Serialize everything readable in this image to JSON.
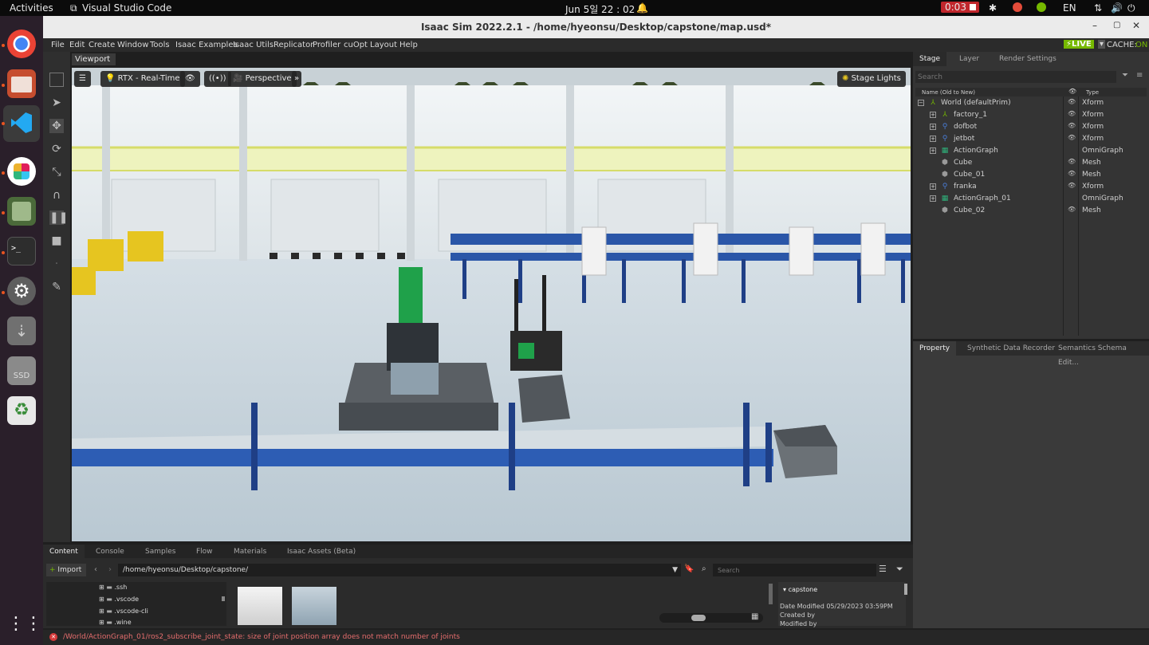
{
  "topbar": {
    "activities": "Activities",
    "app_name": "Visual Studio Code",
    "clock": "Jun 5일 22 : 02",
    "record_time": "0:03",
    "lang": "EN"
  },
  "window": {
    "title": "Isaac Sim 2022.2.1 - /home/hyeonsu/Desktop/capstone/map.usd*"
  },
  "menu": [
    "File",
    "Edit",
    "Create",
    "Window",
    "Tools",
    "Isaac Examples",
    "Isaac Utils",
    "Replicator",
    "Profiler",
    "cuOpt",
    "Layout",
    "Help"
  ],
  "status_right": {
    "live": "LIVE",
    "cache": "CACHE:",
    "cache_state": "ON"
  },
  "viewport": {
    "tab": "Viewport",
    "renderer": "RTX - Real-Time",
    "camera": "Perspective",
    "lights": "Stage Lights"
  },
  "stage": {
    "tabs": [
      "Stage",
      "Layer",
      "Render Settings"
    ],
    "search_placeholder": "Search",
    "col_name": "Name (Old to New)",
    "col_type": "Type",
    "rows": [
      {
        "name": "World (defaultPrim)",
        "type": "Xform"
      },
      {
        "name": "factory_1",
        "type": "Xform"
      },
      {
        "name": "dofbot",
        "type": "Xform"
      },
      {
        "name": "jetbot",
        "type": "Xform"
      },
      {
        "name": "ActionGraph",
        "type": "OmniGraph"
      },
      {
        "name": "Cube",
        "type": "Mesh"
      },
      {
        "name": "Cube_01",
        "type": "Mesh"
      },
      {
        "name": "franka",
        "type": "Xform"
      },
      {
        "name": "ActionGraph_01",
        "type": "OmniGraph"
      },
      {
        "name": "Cube_02",
        "type": "Mesh"
      }
    ]
  },
  "property": {
    "tabs": [
      "Property",
      "Synthetic Data Recorder",
      "Semantics Schema Edit..."
    ]
  },
  "content": {
    "tabs": [
      "Content",
      "Console",
      "Samples",
      "Flow",
      "Materials",
      "Isaac Assets (Beta)"
    ],
    "import_label": "Import",
    "path": "/home/hyeonsu/Desktop/capstone/",
    "search_placeholder": "Search",
    "folders": [
      ".ssh",
      ".vscode",
      ".vscode-cli",
      ".wine"
    ],
    "detail_title": "capstone",
    "date_modified": "Date Modified 05/29/2023 03:59PM",
    "created_by": "Created by",
    "modified_by": "Modified by"
  },
  "statusbar": {
    "error": "/World/ActionGraph_01/ros2_subscribe_joint_state: size of joint position array does not match number of joints"
  },
  "colors": {
    "accent_green": "#76b900",
    "record_red": "#c0262c",
    "dock_bg": "#2a1f2a"
  }
}
